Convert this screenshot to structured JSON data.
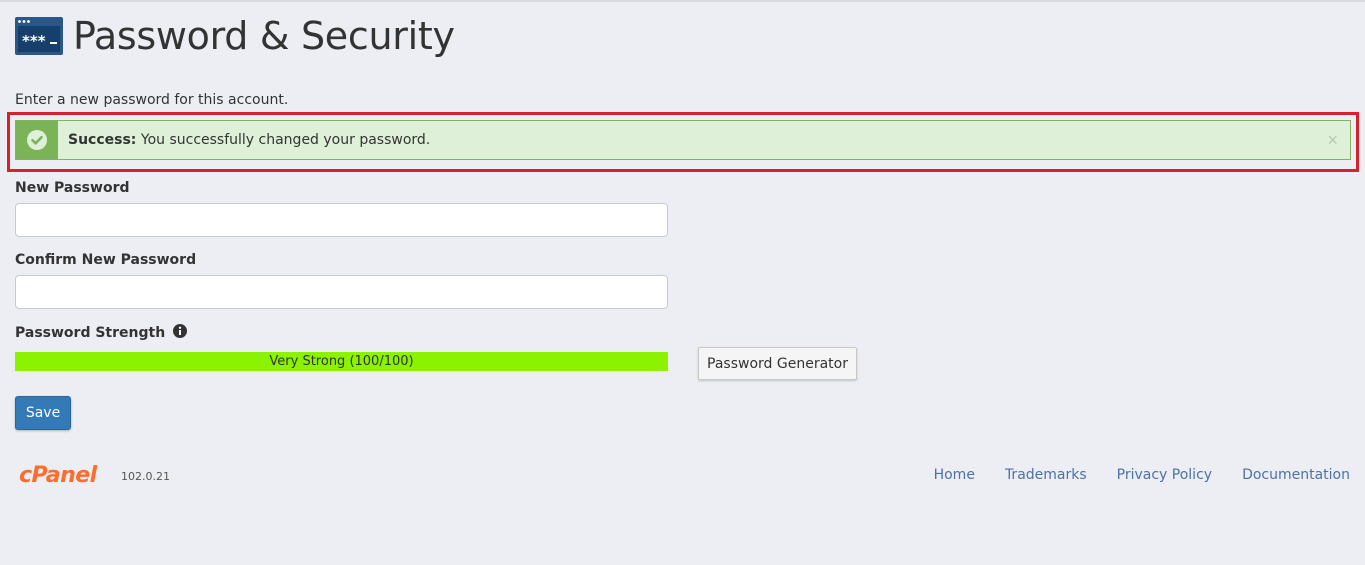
{
  "page": {
    "title": "Password & Security",
    "intro": "Enter a new password for this account."
  },
  "alert": {
    "type": "success",
    "prefix": "Success:",
    "message": "You successfully changed your password.",
    "close_glyph": "×",
    "color": "#7bb357"
  },
  "form": {
    "new_password": {
      "label": "New Password",
      "value": "",
      "placeholder": ""
    },
    "confirm_password": {
      "label": "Confirm New Password",
      "value": "",
      "placeholder": ""
    },
    "strength": {
      "label": "Password Strength",
      "text": "Very Strong (100/100)",
      "score": 100,
      "max": 100,
      "color": "#8bf300"
    },
    "generator_label": "Password Generator",
    "save_label": "Save"
  },
  "footer": {
    "logo_text": "cPanel",
    "version": "102.0.21",
    "links": [
      {
        "label": "Home"
      },
      {
        "label": "Trademarks"
      },
      {
        "label": "Privacy Policy"
      },
      {
        "label": "Documentation"
      }
    ]
  },
  "icons": {
    "title": "password-terminal-icon",
    "alert": "check-circle-icon",
    "info": "info-circle-icon",
    "close": "close-icon"
  },
  "colors": {
    "background": "#eceef3",
    "primary": "#337ab7",
    "link": "#4d71a3",
    "brand": "#ff6c2c",
    "highlight": "#d6222a"
  }
}
